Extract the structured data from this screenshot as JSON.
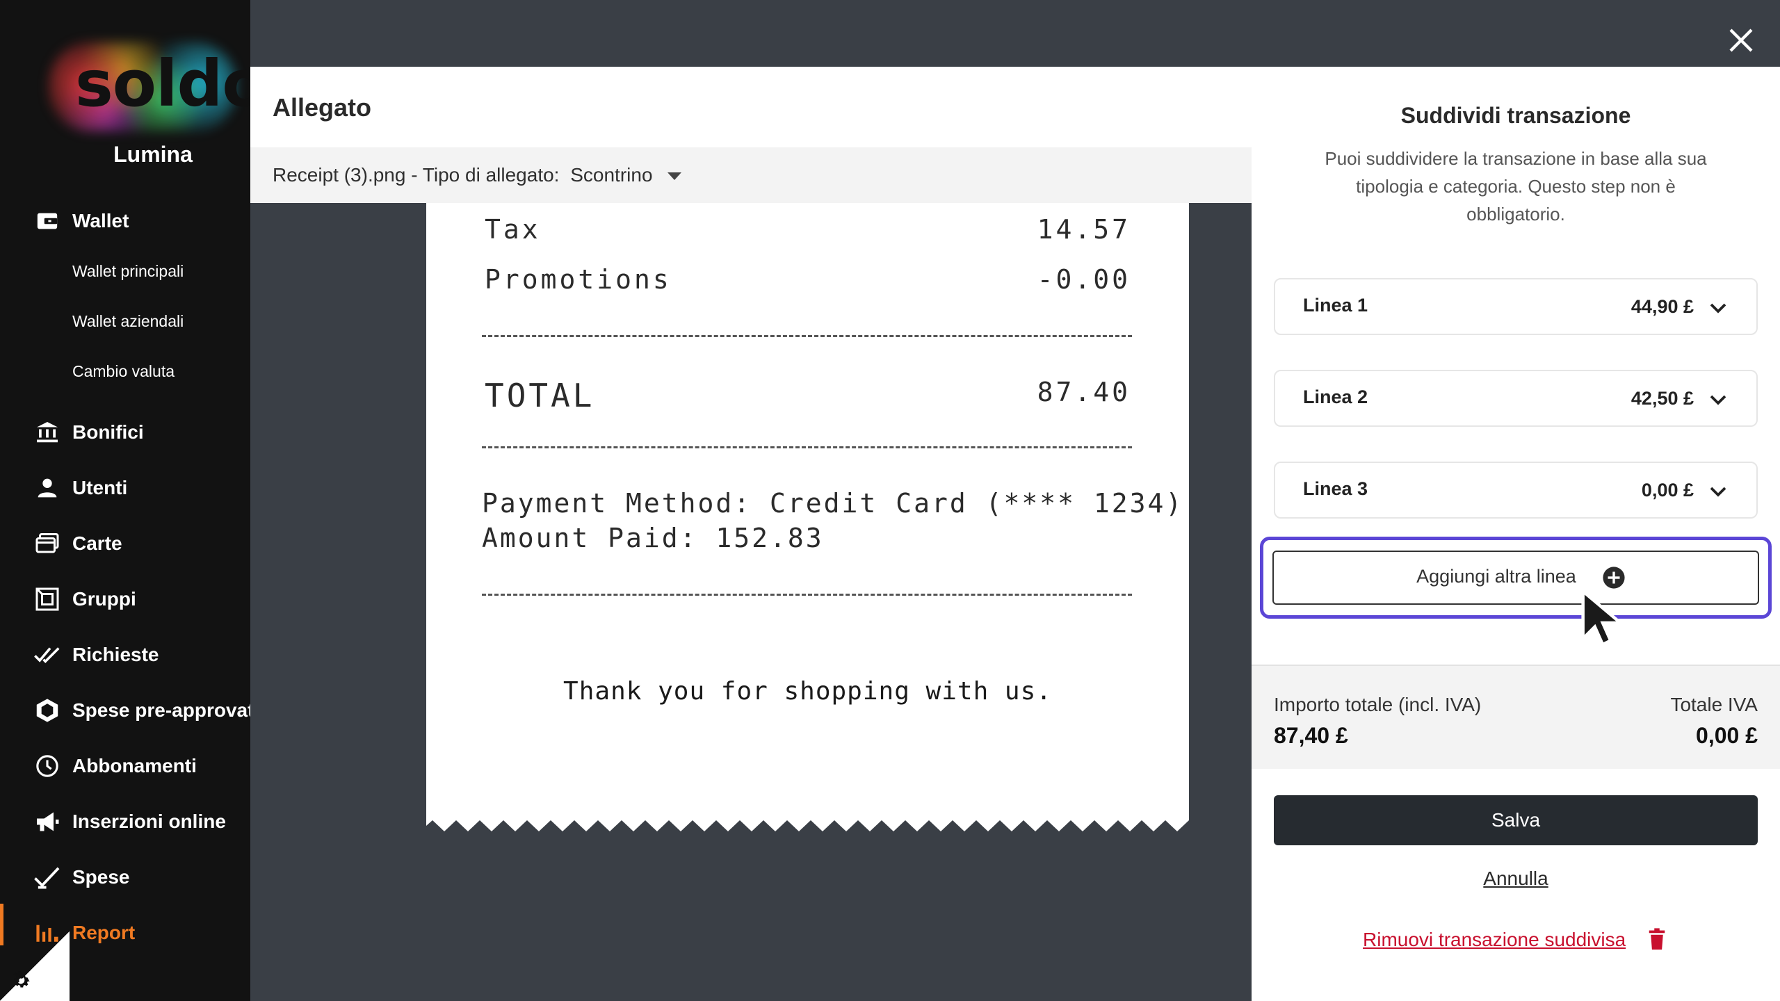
{
  "sidebar": {
    "logo_text": "soldo",
    "org_name": "Lumina",
    "wallet": {
      "label": "Wallet",
      "icon": "wallet-icon"
    },
    "wallet_sub": [
      "Wallet principali",
      "Wallet aziendali",
      "Cambio valuta"
    ],
    "items": [
      {
        "label": "Bonifici",
        "icon": "bank-transfer-icon"
      },
      {
        "label": "Utenti",
        "icon": "user-icon"
      },
      {
        "label": "Carte",
        "icon": "cards-icon"
      },
      {
        "label": "Gruppi",
        "icon": "groups-icon"
      },
      {
        "label": "Richieste",
        "icon": "double-check-icon"
      },
      {
        "label": "Spese pre-approvat",
        "icon": "hexagon-icon"
      },
      {
        "label": "Abbonamenti",
        "icon": "clock-icon"
      },
      {
        "label": "Inserzioni online",
        "icon": "megaphone-icon"
      },
      {
        "label": "Spese",
        "icon": "check-pen-icon"
      },
      {
        "label": "Report",
        "icon": "bar-chart-icon"
      }
    ],
    "active_color": "#f07a22"
  },
  "attachment": {
    "title": "Allegato",
    "file_name": "Receipt (3).png - Tipo di allegato:",
    "type_value": "Scontrino"
  },
  "receipt": {
    "tax_label": "Tax",
    "tax_value": "14.57",
    "promo_label": "Promotions",
    "promo_value": "-0.00",
    "total_label": "TOTAL",
    "total_value": "87.40",
    "payment_line": "Payment Method: Credit Card (**** 1234)",
    "amount_line": "Amount Paid: 152.83",
    "thanks": "Thank you for shopping with us."
  },
  "split": {
    "title": "Suddividi transazione",
    "description": "Puoi suddividere la transazione in base alla sua tipologia e categoria. Questo step non è obbligatorio.",
    "lines": [
      {
        "name": "Linea 1",
        "amount": "44,90 £"
      },
      {
        "name": "Linea 2",
        "amount": "42,50 £"
      },
      {
        "name": "Linea 3",
        "amount": "0,00 £"
      }
    ],
    "add_line_label": "Aggiungi altra linea",
    "total_label": "Importo totale (incl. IVA)",
    "total_value": "87,40 £",
    "vat_label": "Totale IVA",
    "vat_value": "0,00 £",
    "save_label": "Salva",
    "cancel_label": "Annulla",
    "remove_label": "Rimuovi transazione suddivisa",
    "focus_color": "#5b46d6",
    "danger_color": "#c8102e"
  }
}
